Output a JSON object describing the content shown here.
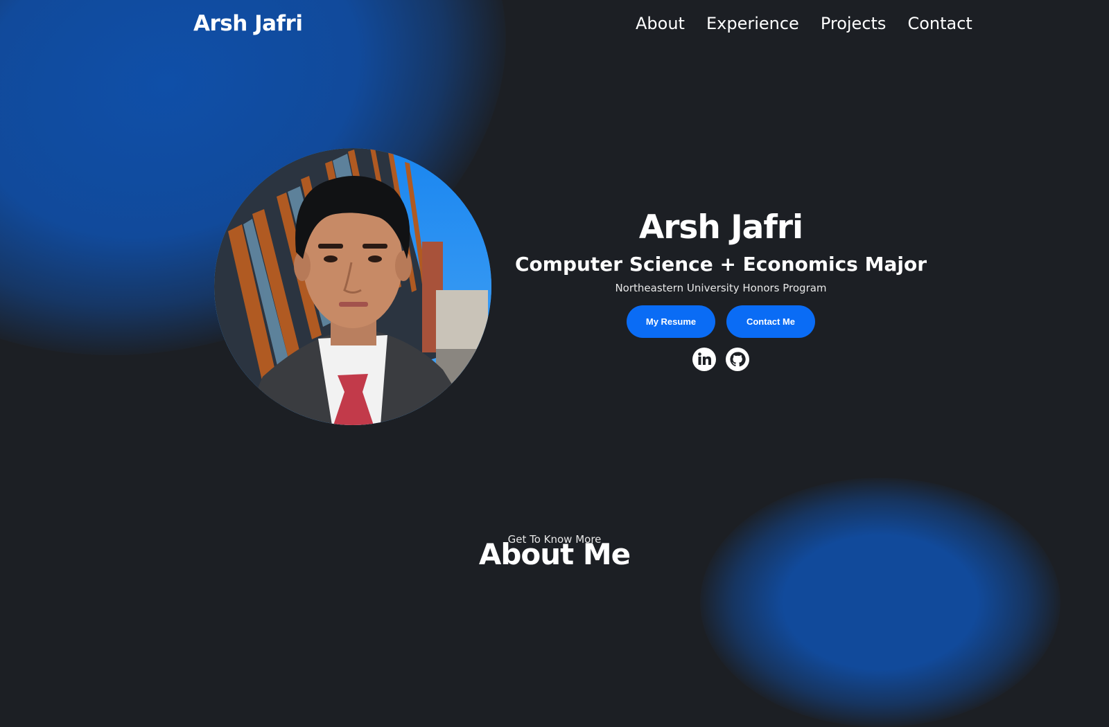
{
  "nav": {
    "logo": "Arsh Jafri",
    "links": [
      "About",
      "Experience",
      "Projects",
      "Contact"
    ]
  },
  "hero": {
    "name": "Arsh Jafri",
    "title": "Computer Science + Economics Major",
    "subtitle": "Northeastern University Honors Program",
    "buttons": [
      "My Resume",
      "Contact Me"
    ],
    "social_icons": [
      "linkedin-icon",
      "github-icon"
    ]
  },
  "about": {
    "subtitle": "Get To Know More",
    "title": "About Me"
  },
  "colors": {
    "background": "#1c1f24",
    "accent": "#0a6cf5",
    "glow": "#114a9b",
    "text": "#ffffff"
  }
}
